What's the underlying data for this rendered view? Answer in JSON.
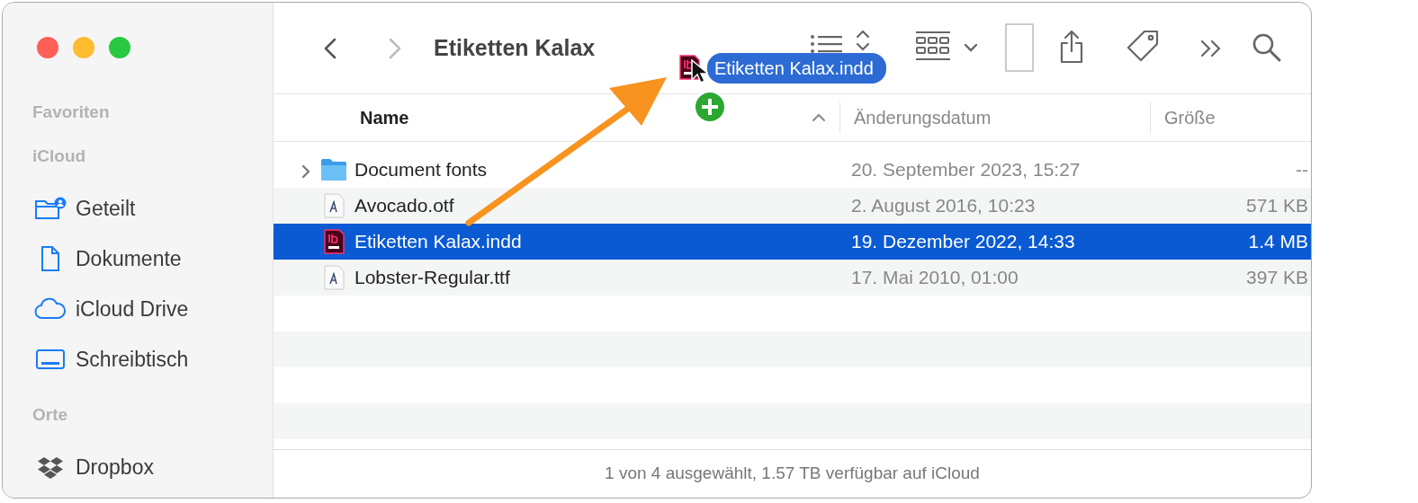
{
  "window": {
    "title": "Etiketten Kalax"
  },
  "navigation": [
    {
      "kind": "back",
      "disabled": false
    },
    {
      "kind": "forward",
      "disabled": true
    }
  ],
  "sidebar": {
    "sections": [
      {
        "title": "Favoriten"
      },
      {
        "title": "iCloud",
        "items": [
          {
            "label": "Geteilt",
            "kind": "shared"
          },
          {
            "label": "Dokumente",
            "kind": "document"
          },
          {
            "label": "iCloud Drive",
            "kind": "cloud"
          },
          {
            "label": "Schreibtisch",
            "kind": "desktop"
          }
        ]
      },
      {
        "title": "Orte",
        "items": [
          {
            "label": "Dropbox",
            "kind": "dropbox"
          }
        ]
      }
    ]
  },
  "table": {
    "columns": [
      {
        "label": "Name",
        "sorted": true
      },
      {
        "label": "Änderungsdatum",
        "sorted": false
      },
      {
        "label": "Größe",
        "sorted": false
      }
    ],
    "rows": [
      {
        "kind": "folder",
        "name": "Document fonts",
        "date": "20. September 2023, 15:27",
        "size": "--",
        "selected": false
      },
      {
        "kind": "font",
        "name": "Avocado.otf",
        "date": "2. August 2016, 10:23",
        "size": "571 KB",
        "selected": false
      },
      {
        "kind": "indesign",
        "name": "Etiketten Kalax.indd",
        "date": "19. Dezember 2022, 14:33",
        "size": "1.4 MB",
        "selected": true
      },
      {
        "kind": "font",
        "name": "Lobster-Regular.ttf",
        "date": "17. Mai 2010, 01:00",
        "size": "397 KB",
        "selected": false
      }
    ]
  },
  "drag": {
    "label": "Etiketten Kalax.indd",
    "kind": "indesign"
  },
  "status_bar": "1 von 4 ausgewählt, 1.57 TB verfügbar auf iCloud"
}
